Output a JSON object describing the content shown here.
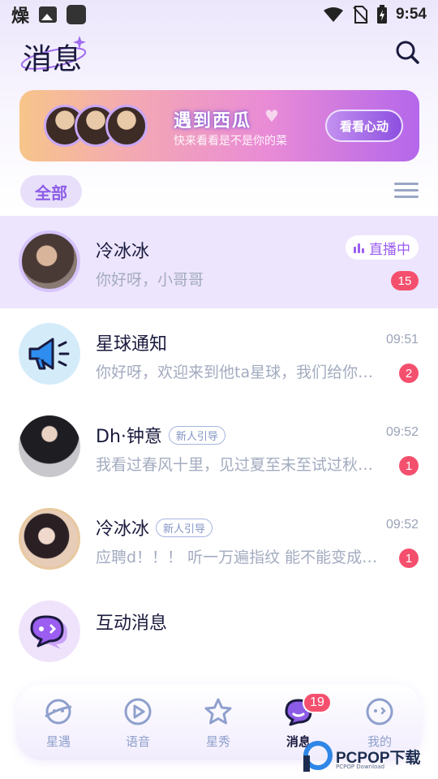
{
  "status_bar": {
    "left_glyph": "燥",
    "time": "9:54"
  },
  "header": {
    "title": "消息",
    "search_icon": "search-icon"
  },
  "banner": {
    "title": "遇到西瓜",
    "subtitle": "快来看看是不是你的菜",
    "button_label": "看看心动"
  },
  "filter": {
    "chip_label": "全部",
    "menu_icon": "menu-icon"
  },
  "conversations": [
    {
      "name": "冷冰冰",
      "preview": "你好呀，小哥哥",
      "time": "",
      "unread": "15",
      "badge": "直播中",
      "tag": ""
    },
    {
      "name": "星球通知",
      "preview": "你好呀，欢迎来到他ta星球，我们给你准备了好玩的",
      "time": "09:51",
      "unread": "2",
      "badge": "",
      "tag": ""
    },
    {
      "name": "Dh·钟意",
      "preview": "我看过春风十里，见过夏至未至试过秋天的风",
      "time": "09:52",
      "unread": "1",
      "badge": "",
      "tag": "新人引导"
    },
    {
      "name": "冷冰冰",
      "preview": "应聘d！！！ 听一万遍指纹 能不能变成你的",
      "time": "09:52",
      "unread": "1",
      "badge": "",
      "tag": "新人引导"
    },
    {
      "name": "互动消息",
      "preview": "",
      "time": "",
      "unread": "",
      "badge": "",
      "tag": ""
    }
  ],
  "bottom_nav": {
    "items": [
      {
        "label": "星遇",
        "icon": "planet-icon"
      },
      {
        "label": "语音",
        "icon": "play-icon"
      },
      {
        "label": "星秀",
        "icon": "star-icon"
      },
      {
        "label": "消息",
        "icon": "chat-bubble-icon",
        "badge": "19"
      },
      {
        "label": "我的",
        "icon": "profile-face-icon"
      }
    ]
  },
  "watermark": {
    "text": "PCPOP下载",
    "sub": "PCPOP Download"
  },
  "colors": {
    "accent": "#9b5ef0",
    "badge_red": "#f4506e",
    "active_row": "#ede5fd"
  }
}
